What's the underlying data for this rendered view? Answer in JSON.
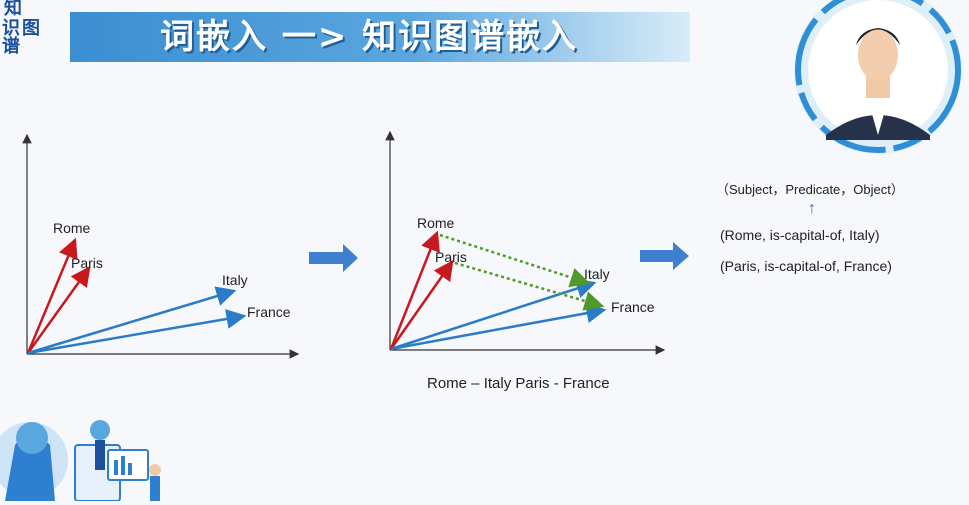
{
  "header": {
    "title": "词嵌入 一> 知识图谱嵌入",
    "logo_chars": [
      "知",
      "识",
      "图",
      "谱"
    ]
  },
  "diagram_left": {
    "labels": {
      "rome": "Rome",
      "paris": "Paris",
      "italy": "Italy",
      "france": "France"
    }
  },
  "diagram_mid": {
    "labels": {
      "rome": "Rome",
      "paris": "Paris",
      "italy": "Italy",
      "france": "France"
    },
    "caption": "Rome – Italy  Paris - France"
  },
  "triples": {
    "schema": "（Subject，Predicate，Object）",
    "up_arrow": "↑",
    "row1": "(Rome, is-capital-of, Italy)",
    "row2": "(Paris,   is-capital-of, France)"
  },
  "colors": {
    "title_band": "#3b8ed1",
    "capital_vector": "#c8191e",
    "country_vector": "#2a7cc7",
    "relation_dash": "#4e9a2a",
    "big_arrow": "#3f7fd0"
  }
}
